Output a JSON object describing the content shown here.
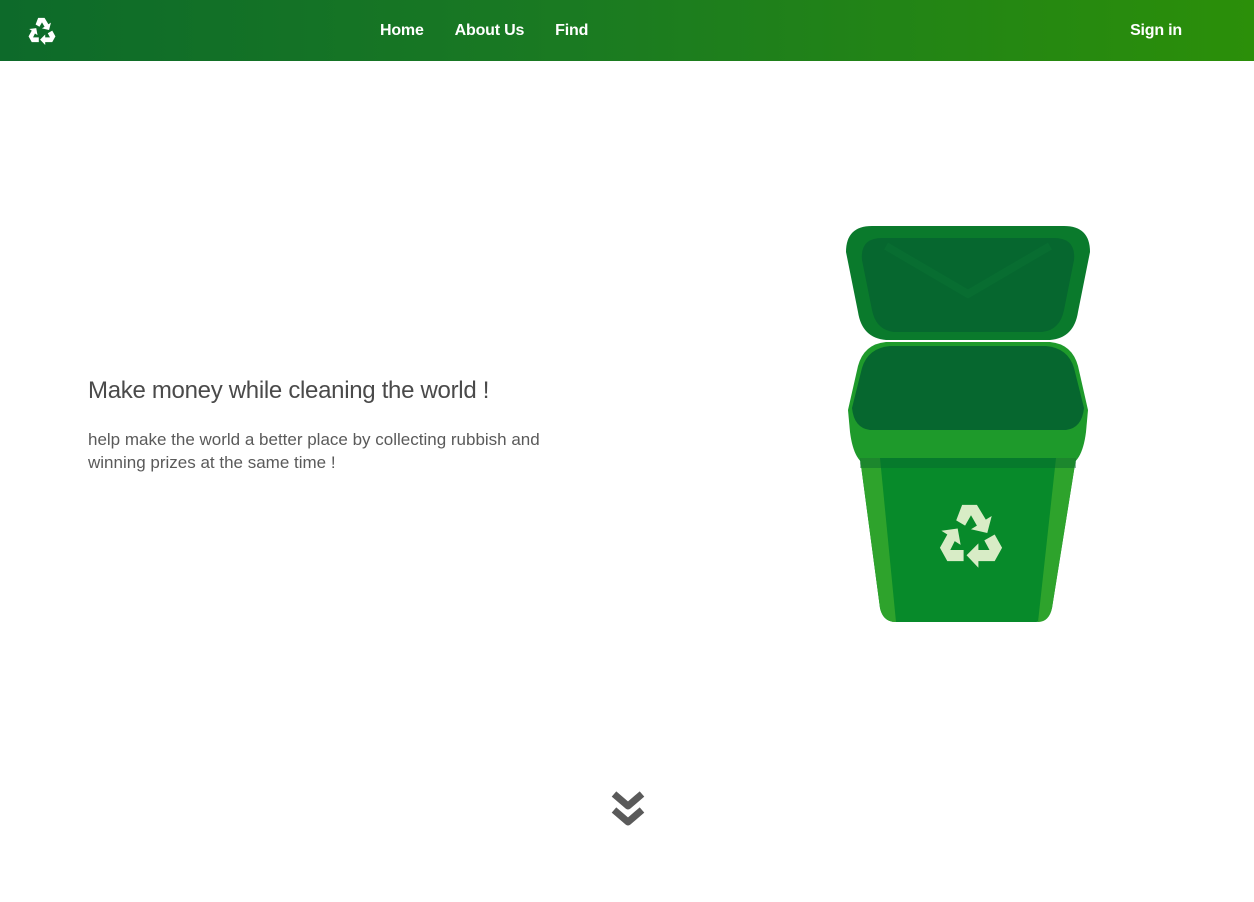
{
  "nav": {
    "logo_icon": "recycle-icon",
    "links": [
      {
        "label": "Home"
      },
      {
        "label": "About Us"
      },
      {
        "label": "Find"
      }
    ],
    "sign_in": "Sign in"
  },
  "hero": {
    "title": "Make money while cleaning the world !",
    "subtitle": "help make the world a better place by collecting rubbish and winning prizes at the same time !",
    "illustration_icon": "recycle-bin-icon"
  },
  "scroll_icon": "double-chevron-down-icon",
  "colors": {
    "nav_start": "#0d6a2a",
    "nav_end": "#2b8f09",
    "bin_dark": "#06672f",
    "bin_main": "#078a2a",
    "bin_light": "#2ea32c",
    "recycle_symbol": "#d8ecc6",
    "text": "#4a4a4a"
  }
}
